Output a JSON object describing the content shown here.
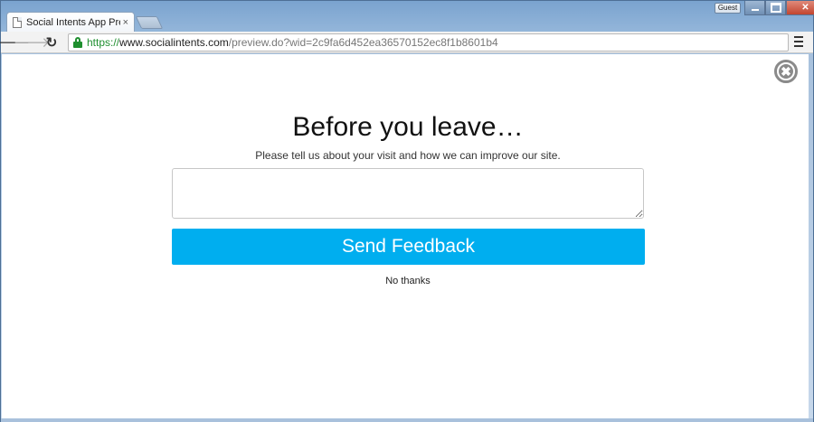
{
  "browser": {
    "tab_title": "Social Intents App Preview",
    "tab_close_glyph": "×",
    "profile_label": "Guest",
    "url": {
      "scheme": "https://",
      "host": "www.socialintents.com",
      "path": "/preview.do?wid=2c9fa6d452ea36570152ec8f1b8601b4"
    },
    "icons": {
      "back": "arrow-left-icon",
      "forward": "arrow-right-icon",
      "reload": "reload-icon",
      "lock": "lock-icon",
      "menu": "hamburger-menu-icon",
      "close_popup": "close-circle-icon"
    }
  },
  "popup": {
    "heading": "Before you leave…",
    "subtext": "Please tell us about your visit and how we can improve our site.",
    "feedback_value": "",
    "send_button_label": "Send Feedback",
    "dismiss_link": "No thanks",
    "accent_color": "#00aeef"
  }
}
